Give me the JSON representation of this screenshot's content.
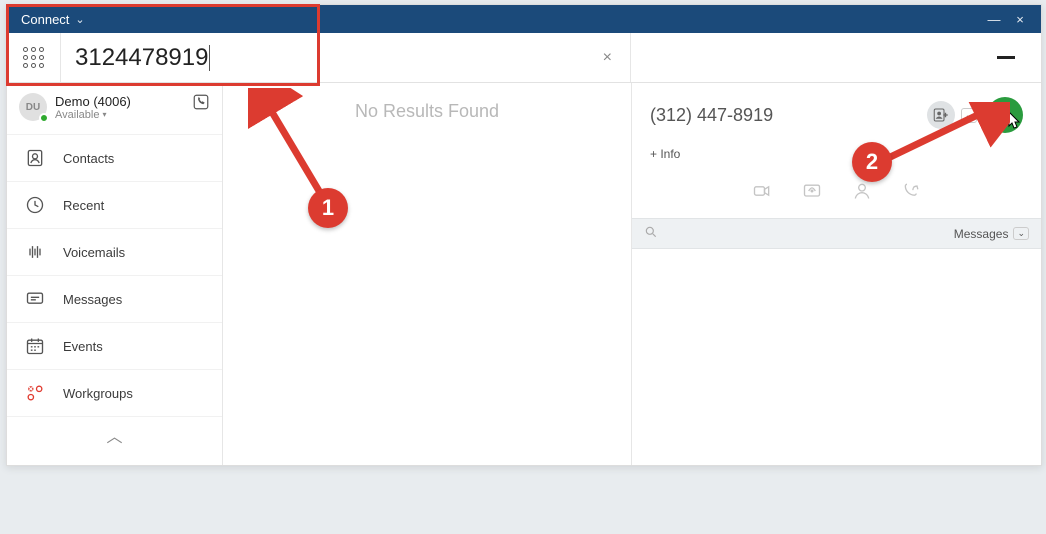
{
  "title": "Connect",
  "search": {
    "value": "3124478919",
    "no_results": "No Results Found"
  },
  "profile": {
    "initials": "DU",
    "name": "Demo",
    "ext": "(4006)",
    "status": "Available"
  },
  "nav": {
    "contacts": "Contacts",
    "recent": "Recent",
    "voicemails": "Voicemails",
    "messages": "Messages",
    "events": "Events",
    "workgroups": "Workgroups"
  },
  "contact": {
    "formatted_number": "(312) 447-8919",
    "info_label": "+ Info"
  },
  "messages_panel": {
    "label": "Messages"
  },
  "icons": {
    "dialpad": "dialpad-icon",
    "close": "×",
    "minimize": "—",
    "window_close": "×"
  },
  "annotations": {
    "step1": "1",
    "step2": "2"
  },
  "colors": {
    "titlebar": "#1b4a7a",
    "accent_red": "#dc3b30",
    "call_green": "#2a9b3e"
  }
}
